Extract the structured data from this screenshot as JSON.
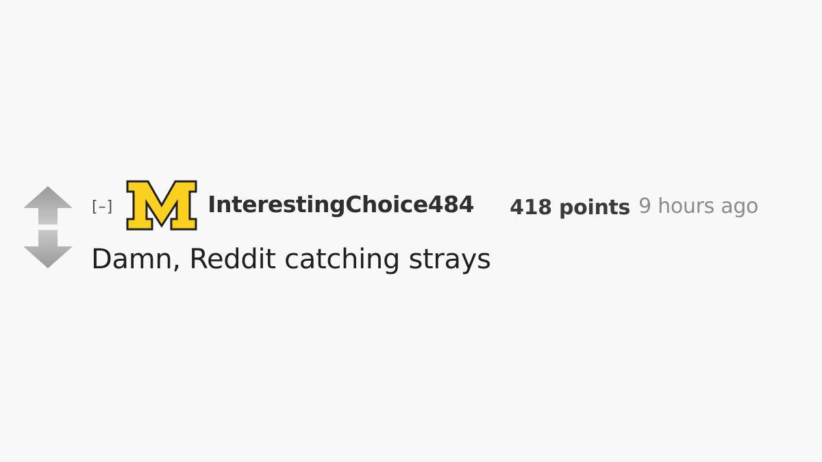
{
  "comment": {
    "collapse_label": "[–]",
    "flair_icon": "michigan-block-m-icon",
    "flair_letter": "M",
    "author": "InterestingChoice484",
    "score": "418 points",
    "timestamp": "9 hours ago",
    "body": "Damn, Reddit catching strays"
  },
  "icons": {
    "upvote": "upvote-arrow-icon",
    "downvote": "downvote-arrow-icon"
  },
  "colors": {
    "background": "#f8f8f9",
    "arrow_gray": "#a8a8a8",
    "flair_maize": "#fcd01f",
    "flair_outline": "#1f1f1f",
    "author_text": "#2f2f2f",
    "timestamp_text": "#8b8b8b"
  }
}
